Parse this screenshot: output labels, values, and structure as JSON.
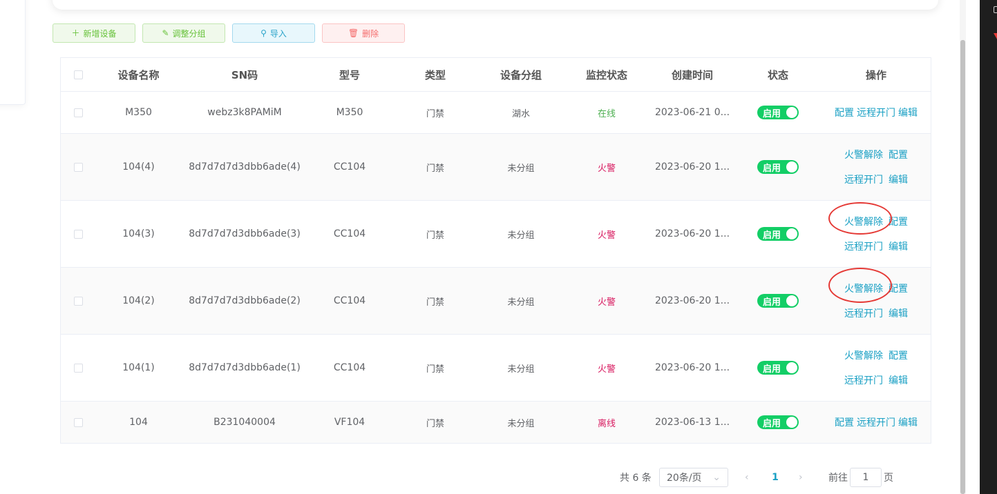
{
  "toolbar": {
    "add": "新增设备",
    "group": "调整分组",
    "import": "导入",
    "delete": "删除"
  },
  "table": {
    "headers": {
      "name": "设备名称",
      "sn": "SN码",
      "model": "型号",
      "type": "类型",
      "group": "设备分组",
      "monitor": "监控状态",
      "created": "创建时间",
      "status": "状态",
      "ops": "操作"
    },
    "rows": [
      {
        "name": "M350",
        "sn": "webz3k8PAMiM",
        "model": "M350",
        "type": "门禁",
        "group": "湖水",
        "monitor": "在线",
        "created": "2023-06-21 0...",
        "status": "启用"
      },
      {
        "name": "104(4)",
        "sn": "8d7d7d7d3dbb6ade(4)",
        "model": "CC104",
        "type": "门禁",
        "group": "未分组",
        "monitor": "火警",
        "created": "2023-06-20 1...",
        "status": "启用"
      },
      {
        "name": "104(3)",
        "sn": "8d7d7d7d3dbb6ade(3)",
        "model": "CC104",
        "type": "门禁",
        "group": "未分组",
        "monitor": "火警",
        "created": "2023-06-20 1...",
        "status": "启用"
      },
      {
        "name": "104(2)",
        "sn": "8d7d7d7d3dbb6ade(2)",
        "model": "CC104",
        "type": "门禁",
        "group": "未分组",
        "monitor": "火警",
        "created": "2023-06-20 1...",
        "status": "启用"
      },
      {
        "name": "104(1)",
        "sn": "8d7d7d7d3dbb6ade(1)",
        "model": "CC104",
        "type": "门禁",
        "group": "未分组",
        "monitor": "火警",
        "created": "2023-06-20 1...",
        "status": "启用"
      },
      {
        "name": "104",
        "sn": "B231040004",
        "model": "VF104",
        "type": "门禁",
        "group": "未分组",
        "monitor": "离线",
        "created": "2023-06-13 1...",
        "status": "启用"
      }
    ],
    "ops": {
      "fire_clear": "火警解除",
      "config": "配置",
      "remote_open": "远程开门",
      "edit": "编辑"
    }
  },
  "pagination": {
    "total": "共 6 条",
    "page_size": "20条/页",
    "current_page": "1",
    "goto_label": "前往",
    "goto_value": "1",
    "page_suffix": "页"
  },
  "colors": {
    "accent": "#1aa0c4",
    "toggle_on": "#13ce66",
    "alarm": "#d81b60",
    "online": "#4caf50",
    "annotation_circle": "#e53935"
  }
}
